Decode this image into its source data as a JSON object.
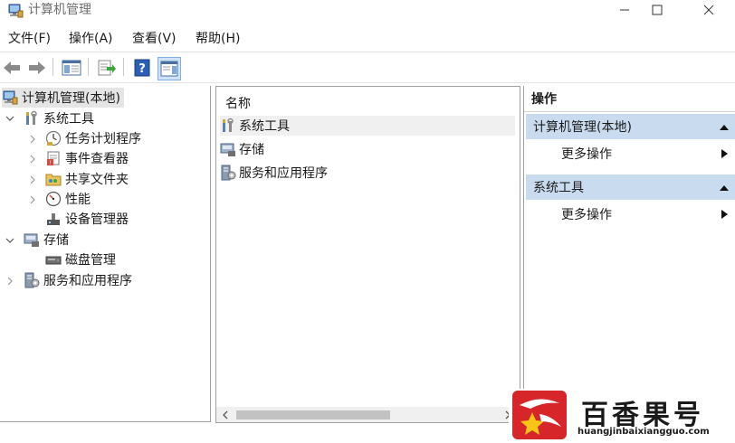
{
  "window": {
    "title": "计算机管理"
  },
  "menu": [
    "文件(F)",
    "操作(A)",
    "查看(V)",
    "帮助(H)"
  ],
  "toolbar": {
    "buttons": [
      "back-icon",
      "forward-icon",
      "console-tree-icon",
      "export-list-icon",
      "help-icon",
      "action-pane-icon"
    ]
  },
  "tree": {
    "root": "计算机管理(本地)",
    "system_tools": "系统工具",
    "task_scheduler": "任务计划程序",
    "event_viewer": "事件查看器",
    "shared_folders": "共享文件夹",
    "performance": "性能",
    "device_manager": "设备管理器",
    "storage": "存储",
    "disk_management": "磁盘管理",
    "services_apps": "服务和应用程序"
  },
  "list": {
    "column_name": "名称",
    "items": [
      "系统工具",
      "存储",
      "服务和应用程序"
    ]
  },
  "actions": {
    "header": "操作",
    "section1": "计算机管理(本地)",
    "section1_item": "更多操作",
    "section2": "系统工具",
    "section2_item": "更多操作"
  },
  "watermark": {
    "name": "百香果号",
    "url": "huangjinbaixiangguo.com"
  }
}
